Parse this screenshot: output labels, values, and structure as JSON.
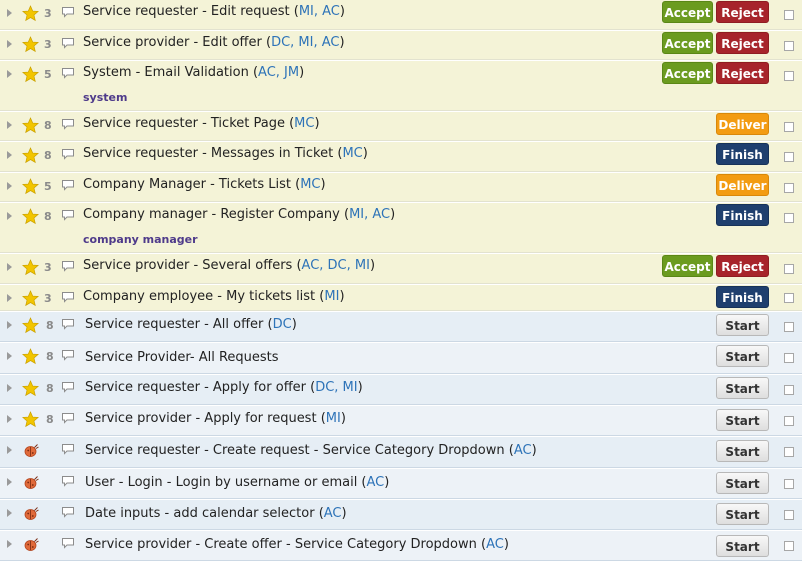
{
  "labels": {
    "accept": "Accept",
    "reject": "Reject",
    "deliver": "Deliver",
    "finish": "Finish",
    "start": "Start"
  },
  "colors": {
    "accept": "#6b9b1f",
    "reject": "#a7242b",
    "deliver": "#f39c12",
    "finish": "#1f3f6e",
    "tag": "#2d73b8",
    "subtitle": "#4e3a8a",
    "row_accepted": "#f4f3d7",
    "row_backlog": "#e6eef5"
  },
  "tasks": [
    {
      "icon": "star-icon",
      "points": "3",
      "title": "Service requester - Edit request (",
      "tags": "MI, AC",
      "close": ")",
      "subtitle": "",
      "actions": [
        "accept",
        "reject"
      ]
    },
    {
      "icon": "star-icon",
      "points": "3",
      "title": "Service provider - Edit offer (",
      "tags": "DC, MI, AC",
      "close": ")",
      "subtitle": "",
      "actions": [
        "accept",
        "reject"
      ]
    },
    {
      "icon": "star-icon",
      "points": "5",
      "title": "System - Email Validation (",
      "tags": "AC, JM",
      "close": ")",
      "subtitle": "system",
      "actions": [
        "accept",
        "reject"
      ]
    },
    {
      "icon": "star-icon",
      "points": "8",
      "title": "Service requester - Ticket Page (",
      "tags": "MC",
      "close": ")",
      "subtitle": "",
      "actions": [
        "deliver"
      ]
    },
    {
      "icon": "star-icon",
      "points": "8",
      "title": "Service requester - Messages in Ticket (",
      "tags": "MC",
      "close": ")",
      "subtitle": "",
      "actions": [
        "finish"
      ]
    },
    {
      "icon": "star-icon",
      "points": "5",
      "title": "Company Manager - Tickets List (",
      "tags": "MC",
      "close": ")",
      "subtitle": "",
      "actions": [
        "deliver"
      ]
    },
    {
      "icon": "star-icon",
      "points": "8",
      "title": "Company manager - Register Company  (",
      "tags": "MI, AC",
      "close": ")",
      "subtitle": "company manager",
      "actions": [
        "finish"
      ]
    },
    {
      "icon": "star-icon",
      "points": "3",
      "title": "Service provider - Several offers (",
      "tags": "AC, DC, MI",
      "close": ")",
      "subtitle": "",
      "actions": [
        "accept",
        "reject"
      ]
    },
    {
      "icon": "star-icon",
      "points": "3",
      "title": "Company employee - My tickets list (",
      "tags": "MI",
      "close": ")",
      "subtitle": "",
      "actions": [
        "finish"
      ]
    },
    {
      "icon": "star-icon",
      "points": "8",
      "title": "Service requester - All offer (",
      "tags": "DC",
      "close": ")",
      "subtitle": "",
      "actions": [
        "start"
      ]
    },
    {
      "icon": "star-icon",
      "points": "8",
      "title": "Service Provider- All Requests",
      "tags": "",
      "close": "",
      "subtitle": "",
      "actions": [
        "start"
      ]
    },
    {
      "icon": "star-icon",
      "points": "8",
      "title": "Service requester - Apply for offer (",
      "tags": "DC, MI",
      "close": ")",
      "subtitle": "",
      "actions": [
        "start"
      ]
    },
    {
      "icon": "star-icon",
      "points": "8",
      "title": "Service provider - Apply for request (",
      "tags": "MI",
      "close": ")",
      "subtitle": "",
      "actions": [
        "start"
      ]
    },
    {
      "icon": "bug-icon",
      "points": "",
      "title": "Service requester - Create request - Service Category Dropdown (",
      "tags": "AC",
      "close": ")",
      "subtitle": "",
      "actions": [
        "start"
      ]
    },
    {
      "icon": "bug-icon",
      "points": "",
      "title": "User - Login - Login by username or email (",
      "tags": "AC",
      "close": ")",
      "subtitle": "",
      "actions": [
        "start"
      ]
    },
    {
      "icon": "bug-icon",
      "points": "",
      "title": "Date inputs - add calendar selector (",
      "tags": "AC",
      "close": ")",
      "subtitle": "",
      "actions": [
        "start"
      ]
    },
    {
      "icon": "bug-icon",
      "points": "",
      "title": "Service provider - Create offer - Service Category Dropdown (",
      "tags": "AC",
      "close": ")",
      "subtitle": "",
      "actions": [
        "start"
      ]
    }
  ]
}
